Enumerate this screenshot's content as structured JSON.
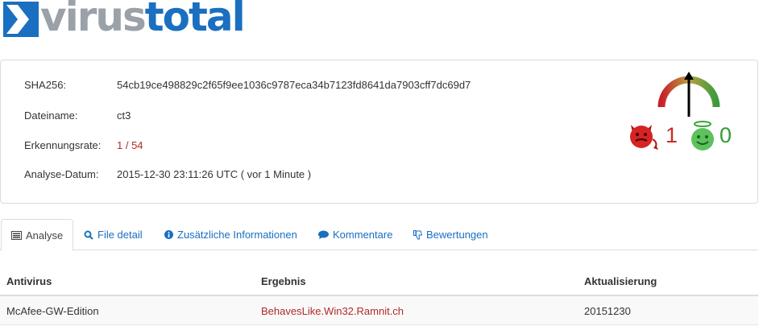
{
  "logo": {
    "part1": "virus",
    "part2": "total"
  },
  "summary": {
    "sha256_label": "SHA256:",
    "sha256_value": "54cb19ce498829c2f65f9ee1036c9787eca34b7123fd8641da7903cff7dc69d7",
    "filename_label": "Dateiname:",
    "filename_value": "ct3",
    "detection_label": "Erkennungsrate:",
    "detection_value": "1 / 54",
    "date_label": "Analyse-Datum:",
    "date_value": "2015-12-30 23:11:26 UTC ( vor 1 Minute )"
  },
  "votes": {
    "malicious": "1",
    "harmless": "0"
  },
  "tabs": [
    {
      "label": "Analyse",
      "icon": "list-icon"
    },
    {
      "label": "File detail",
      "icon": "magnifier-icon"
    },
    {
      "label": "Zusätzliche Informationen",
      "icon": "info-icon"
    },
    {
      "label": "Kommentare",
      "icon": "comment-icon"
    },
    {
      "label": "Bewertungen",
      "icon": "thumbs-down-icon"
    }
  ],
  "table": {
    "headers": [
      "Antivirus",
      "Ergebnis",
      "Aktualisierung"
    ],
    "rows": [
      {
        "antivirus": "McAfee-GW-Edition",
        "result": "BehavesLike.Win32.Ramnit.ch",
        "update": "20151230"
      }
    ]
  },
  "colors": {
    "brand_blue": "#1a6fc0",
    "logo_grey": "#9aa1a8",
    "malicious_red": "#b12a2a",
    "harmless_green": "#2f9e2f"
  }
}
